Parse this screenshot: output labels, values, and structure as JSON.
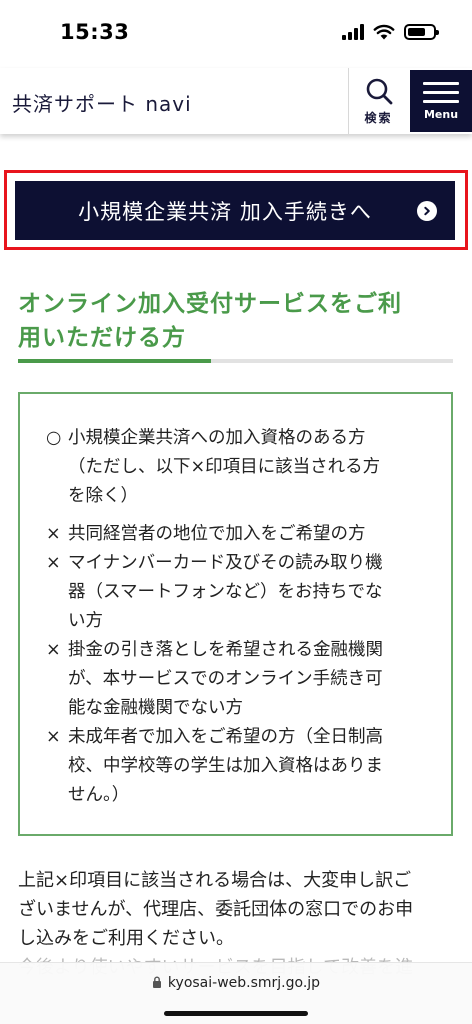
{
  "status_bar": {
    "time": "15:33"
  },
  "header": {
    "site_title": "共済サポート navi",
    "search_label": "検索",
    "menu_label": "Menu"
  },
  "cta": {
    "label": "小規模企業共済 加入手続きへ"
  },
  "section": {
    "title_line1": "オンライン加入受付サービスをご利",
    "title_line2": "用いただける方"
  },
  "criteria": {
    "eligible": {
      "mark": "○",
      "lines": [
        "小規模企業共済への加入資格のある方",
        "（ただし、以下×印項目に該当される方",
        "を除く）"
      ]
    },
    "exclusions": [
      {
        "mark": "×",
        "lines": [
          "共同経営者の地位で加入をご希望の方"
        ]
      },
      {
        "mark": "×",
        "lines": [
          "マイナンバーカード及びその読み取り機",
          "器（スマートフォンなど）をお持ちでな",
          "い方"
        ]
      },
      {
        "mark": "×",
        "lines": [
          "掛金の引き落としを希望される金融機関",
          "が、本サービスでのオンライン手続き可",
          "能な金融機関でない方"
        ]
      },
      {
        "mark": "×",
        "lines": [
          "未成年者で加入をご希望の方（全日制高",
          "校、中学校等の学生は加入資格はありま",
          "せん。）"
        ]
      }
    ]
  },
  "body_text": {
    "lines": [
      "上記×印項目に該当される場合は、大変申し訳ご",
      "ざいませんが、代理店、委託団体の窓口でのお申",
      "し込みをご利用ください。"
    ],
    "faded_line": "今後より使いやすいサービスを目指して改善を進"
  },
  "url_bar": {
    "domain": "kyosai-web.smrj.go.jp"
  },
  "colors": {
    "navy": "#0d1033",
    "accent_green": "#4a9a4a",
    "highlight_red": "#e8141c"
  }
}
